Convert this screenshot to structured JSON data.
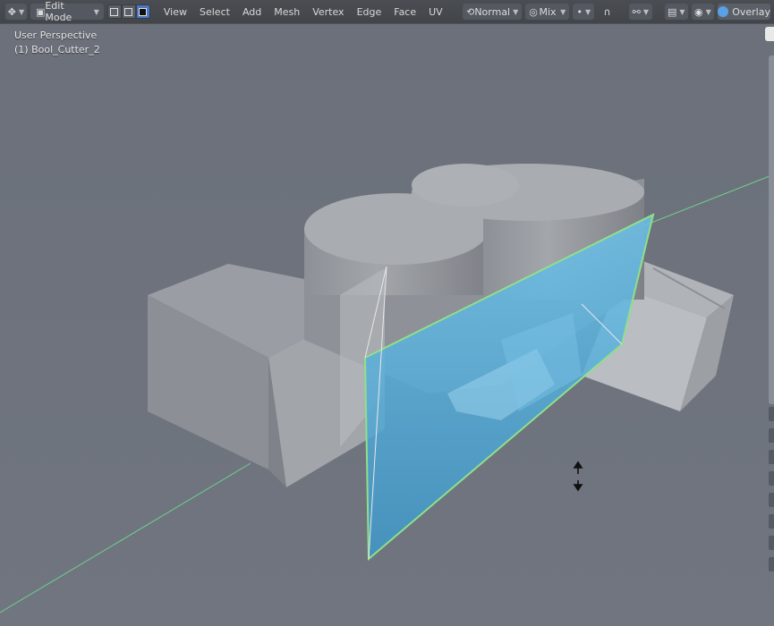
{
  "header": {
    "editor_type_icon": "transform-gizmo-icon",
    "mode": "Edit Mode",
    "select_modes": [
      "vertex-select-icon",
      "edge-select-icon",
      "face-select-icon"
    ],
    "menus": [
      "View",
      "Select",
      "Add",
      "Mesh",
      "Vertex",
      "Edge",
      "Face",
      "UV"
    ],
    "orientation": "Normal",
    "pivot_label": "Mix",
    "snap_icon": "snap-icon",
    "proportional_icon": "proportional-falloff-icon",
    "overlay_label": "Overlay"
  },
  "viewport": {
    "perspective": "User Perspective",
    "object": "(1) Bool_Cutter_2"
  },
  "colors": {
    "background": "#6d727c",
    "header": "#45484d",
    "selection_face": "#5fb6e6",
    "selection_edge": "#8fe08a",
    "axis_line": "#6fcf8f"
  }
}
